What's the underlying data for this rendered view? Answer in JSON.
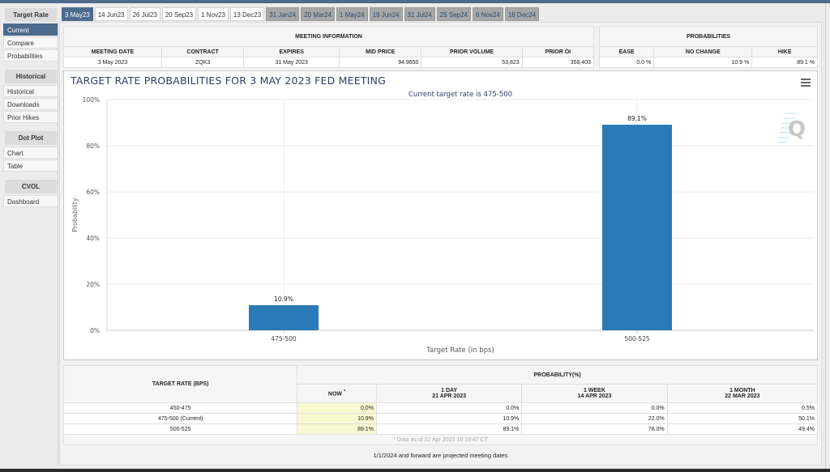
{
  "sidebar": {
    "sections": [
      {
        "title": "Target Rate",
        "items": [
          "Current",
          "Compare",
          "Probabilities"
        ],
        "active": 0
      },
      {
        "title": "Historical",
        "items": [
          "Historical",
          "Downloads",
          "Prior Hikes"
        ]
      },
      {
        "title": "Dot Plot",
        "items": [
          "Chart",
          "Table"
        ]
      },
      {
        "title": "CVOL",
        "items": [
          "Dashboard"
        ]
      }
    ]
  },
  "tabs": [
    {
      "label": "3 May23",
      "state": "active"
    },
    {
      "label": "14 Jun23",
      "state": "normal"
    },
    {
      "label": "26 Jul23",
      "state": "normal"
    },
    {
      "label": "20 Sep23",
      "state": "normal"
    },
    {
      "label": "1 Nov23",
      "state": "normal"
    },
    {
      "label": "13 Dec23",
      "state": "normal"
    },
    {
      "label": "31 Jan24",
      "state": "future"
    },
    {
      "label": "20 Mar24",
      "state": "future"
    },
    {
      "label": "1 May24",
      "state": "future"
    },
    {
      "label": "19 Jun24",
      "state": "future"
    },
    {
      "label": "31 Jul24",
      "state": "future"
    },
    {
      "label": "25 Sep24",
      "state": "future"
    },
    {
      "label": "6 Nov24",
      "state": "future"
    },
    {
      "label": "18 Dec24",
      "state": "future"
    }
  ],
  "meeting_info": {
    "caption": "MEETING INFORMATION",
    "headers": [
      "MEETING DATE",
      "CONTRACT",
      "EXPIRES",
      "MID PRICE",
      "PRIOR VOLUME",
      "PRIOR OI"
    ],
    "row": [
      "3 May 2023",
      "ZQK3",
      "31 May 2023",
      "94.9650",
      "53,823",
      "358,403"
    ]
  },
  "probabilities": {
    "caption": "PROBABILITIES",
    "headers": [
      "EASE",
      "NO CHANGE",
      "HIKE"
    ],
    "row": [
      "0.0 %",
      "10.9 %",
      "89.1 %"
    ]
  },
  "chart_data": {
    "type": "bar",
    "title": "TARGET RATE PROBABILITIES FOR 3 MAY 2023 FED MEETING",
    "subtitle": "Current target rate is 475-500",
    "xlabel": "Target Rate (in bps)",
    "ylabel": "Probability",
    "categories": [
      "475-500",
      "500-525"
    ],
    "values": [
      10.9,
      89.1
    ],
    "data_labels": [
      "10.9%",
      "89.1%"
    ],
    "ylim": [
      0,
      100
    ],
    "yticks": [
      "0%",
      "20%",
      "40%",
      "60%",
      "80%",
      "100%"
    ],
    "ytick_values": [
      0,
      20,
      40,
      60,
      80,
      100
    ],
    "grid": true,
    "bar_color": "#2a7ab8",
    "legend": "none"
  },
  "prob_table": {
    "rate_header": "TARGET RATE (BPS)",
    "group_header": "PROBABILITY(%)",
    "columns": [
      {
        "line1": "NOW",
        "line2": "",
        "star": "*"
      },
      {
        "line1": "1 DAY",
        "line2": "21 APR 2023"
      },
      {
        "line1": "1 WEEK",
        "line2": "14 APR 2023"
      },
      {
        "line1": "1 MONTH",
        "line2": "22 MAR 2023"
      }
    ],
    "rows": [
      {
        "rate": "450-475",
        "values": [
          "0.0%",
          "0.0%",
          "0.0%",
          "0.5%"
        ]
      },
      {
        "rate": "475-500 (Current)",
        "values": [
          "10.9%",
          "10.9%",
          "22.0%",
          "50.1%"
        ]
      },
      {
        "rate": "500-525",
        "values": [
          "89.1%",
          "89.1%",
          "78.0%",
          "49.4%"
        ]
      }
    ],
    "footnote": "* Data as of 22 Apr 2023 10:19:47 CT"
  },
  "note": "1/1/2024 and forward are projected meeting dates",
  "menu_icon": "hamburger-menu-icon",
  "watermark": "Q"
}
